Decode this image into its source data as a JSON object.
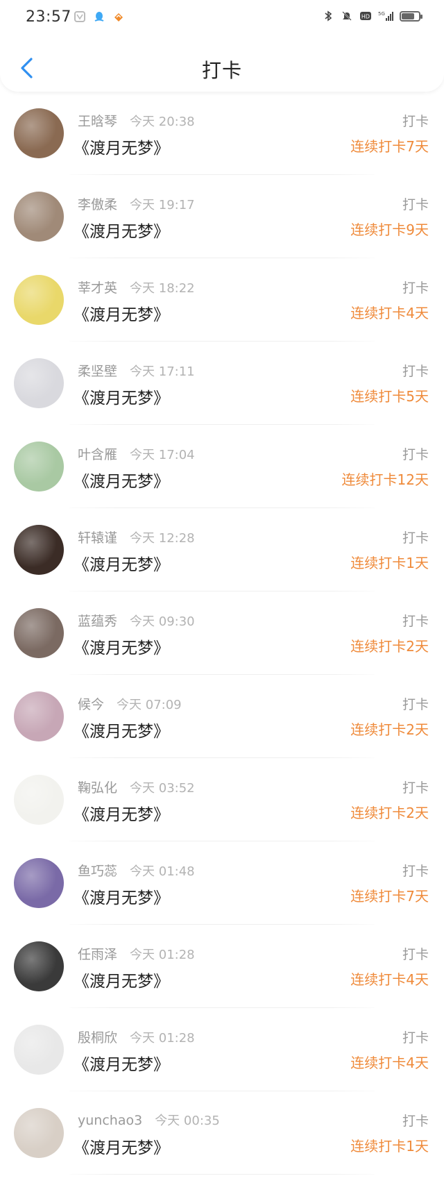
{
  "status_bar": {
    "time": "23:57"
  },
  "header": {
    "title": "打卡"
  },
  "rows": [
    {
      "name": "王晗琴",
      "time": "今天 20:38",
      "book": "《渡月无梦》",
      "tag": "打卡",
      "streak": "连续打卡7天",
      "avatar_color": "#8a6a52"
    },
    {
      "name": "李傲柔",
      "time": "今天 19:17",
      "book": "《渡月无梦》",
      "tag": "打卡",
      "streak": "连续打卡9天",
      "avatar_color": "#a08a78"
    },
    {
      "name": "莘才英",
      "time": "今天 18:22",
      "book": "《渡月无梦》",
      "tag": "打卡",
      "streak": "连续打卡4天",
      "avatar_color": "#e9d86a"
    },
    {
      "name": "柔坚壁",
      "time": "今天 17:11",
      "book": "《渡月无梦》",
      "tag": "打卡",
      "streak": "连续打卡5天",
      "avatar_color": "#d9d9de"
    },
    {
      "name": "叶含雁",
      "time": "今天 17:04",
      "book": "《渡月无梦》",
      "tag": "打卡",
      "streak": "连续打卡12天",
      "avatar_color": "#a9c9a3"
    },
    {
      "name": "轩辕谨",
      "time": "今天 12:28",
      "book": "《渡月无梦》",
      "tag": "打卡",
      "streak": "连续打卡1天",
      "avatar_color": "#3b2c26"
    },
    {
      "name": "蓝蕴秀",
      "time": "今天 09:30",
      "book": "《渡月无梦》",
      "tag": "打卡",
      "streak": "连续打卡2天",
      "avatar_color": "#7b6a62"
    },
    {
      "name": "候今",
      "time": "今天 07:09",
      "book": "《渡月无梦》",
      "tag": "打卡",
      "streak": "连续打卡2天",
      "avatar_color": "#c7a7b6"
    },
    {
      "name": "鞠弘化",
      "time": "今天 03:52",
      "book": "《渡月无梦》",
      "tag": "打卡",
      "streak": "连续打卡2天",
      "avatar_color": "#f2f2ee"
    },
    {
      "name": "鱼巧蕊",
      "time": "今天 01:48",
      "book": "《渡月无梦》",
      "tag": "打卡",
      "streak": "连续打卡7天",
      "avatar_color": "#7a6aa7"
    },
    {
      "name": "任雨泽",
      "time": "今天 01:28",
      "book": "《渡月无梦》",
      "tag": "打卡",
      "streak": "连续打卡4天",
      "avatar_color": "#3a3a3a"
    },
    {
      "name": "殷桐欣",
      "time": "今天 01:28",
      "book": "《渡月无梦》",
      "tag": "打卡",
      "streak": "连续打卡4天",
      "avatar_color": "#e8e8e8"
    },
    {
      "name": "yunchao3",
      "time": "今天 00:35",
      "book": "《渡月无梦》",
      "tag": "打卡",
      "streak": "连续打卡1天",
      "avatar_color": "#d8cfc6"
    }
  ]
}
